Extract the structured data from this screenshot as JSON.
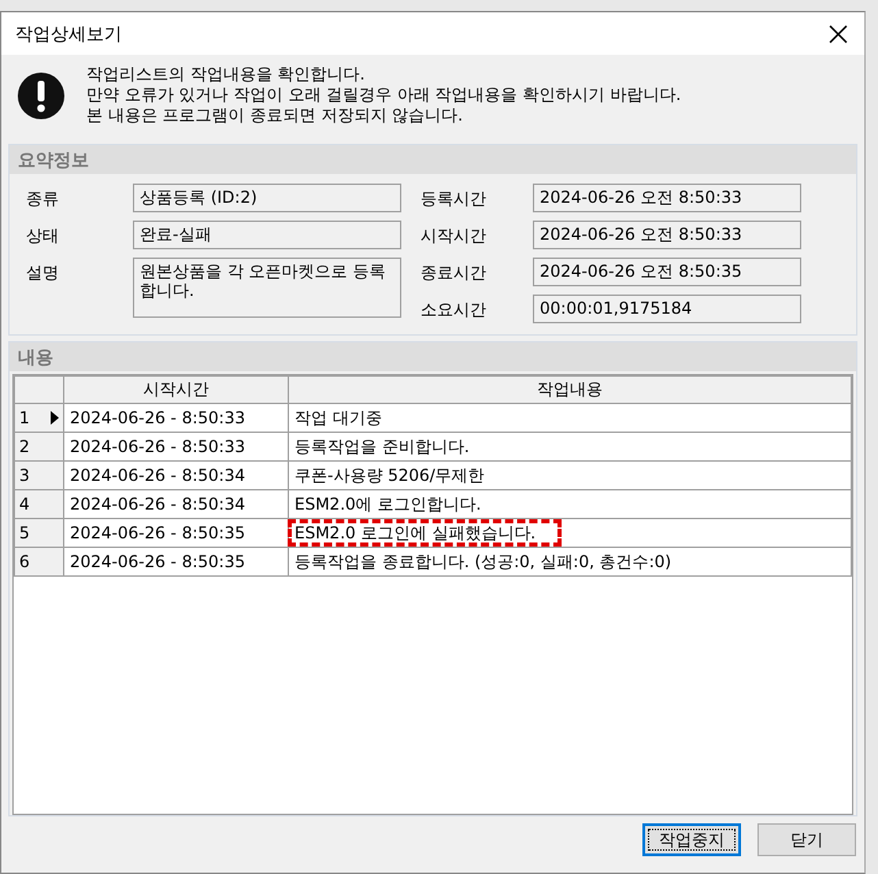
{
  "window": {
    "title": "작업상세보기"
  },
  "notice": {
    "lines": [
      "작업리스트의 작업내용을 확인합니다.",
      "만약 오류가 있거나 작업이 오래 걸릴경우 아래 작업내용을 확인하시기 바랍니다.",
      "본 내용은 프로그램이 종료되면 저장되지 않습니다."
    ]
  },
  "summary": {
    "title": "요약정보",
    "left_fields": [
      {
        "label": "종류",
        "value": "상품등록 (ID:2)"
      },
      {
        "label": "상태",
        "value": "완료-실패"
      },
      {
        "label": "설명",
        "value": "원본상품을 각 오픈마켓으로 등록 합니다.",
        "kind": "multiline"
      }
    ],
    "right_fields": [
      {
        "label": "등록시간",
        "value": "2024-06-26 오전 8:50:33"
      },
      {
        "label": "시작시간",
        "value": "2024-06-26 오전 8:50:33"
      },
      {
        "label": "종료시간",
        "value": "2024-06-26 오전 8:50:35"
      },
      {
        "label": "소요시간",
        "value": "00:00:01,9175184"
      }
    ]
  },
  "content": {
    "title": "내용",
    "table": {
      "columns": [
        "시작시간",
        "작업내용"
      ],
      "rows": [
        {
          "number": "1",
          "time": "2024-06-26  -  8:50:33",
          "message": "작업 대기중",
          "selected": true,
          "highlighted": false
        },
        {
          "number": "2",
          "time": "2024-06-26  -  8:50:33",
          "message": "등록작업을 준비합니다.",
          "selected": false,
          "highlighted": false
        },
        {
          "number": "3",
          "time": "2024-06-26  -  8:50:34",
          "message": "쿠폰-사용량 5206/무제한",
          "selected": false,
          "highlighted": false
        },
        {
          "number": "4",
          "time": "2024-06-26  -  8:50:34",
          "message": "ESM2.0에 로그인합니다.",
          "selected": false,
          "highlighted": false
        },
        {
          "number": "5",
          "time": "2024-06-26  -  8:50:35",
          "message": "ESM2.0 로그인에 실패했습니다.",
          "selected": false,
          "highlighted": true
        },
        {
          "number": "6",
          "time": "2024-06-26  -  8:50:35",
          "message": "등록작업을 종료합니다. (성공:0, 실패:0, 총건수:0)",
          "selected": false,
          "highlighted": false
        }
      ]
    }
  },
  "buttons": [
    {
      "label": "작업중지",
      "default": true
    },
    {
      "label": "닫기",
      "default": false
    }
  ]
}
